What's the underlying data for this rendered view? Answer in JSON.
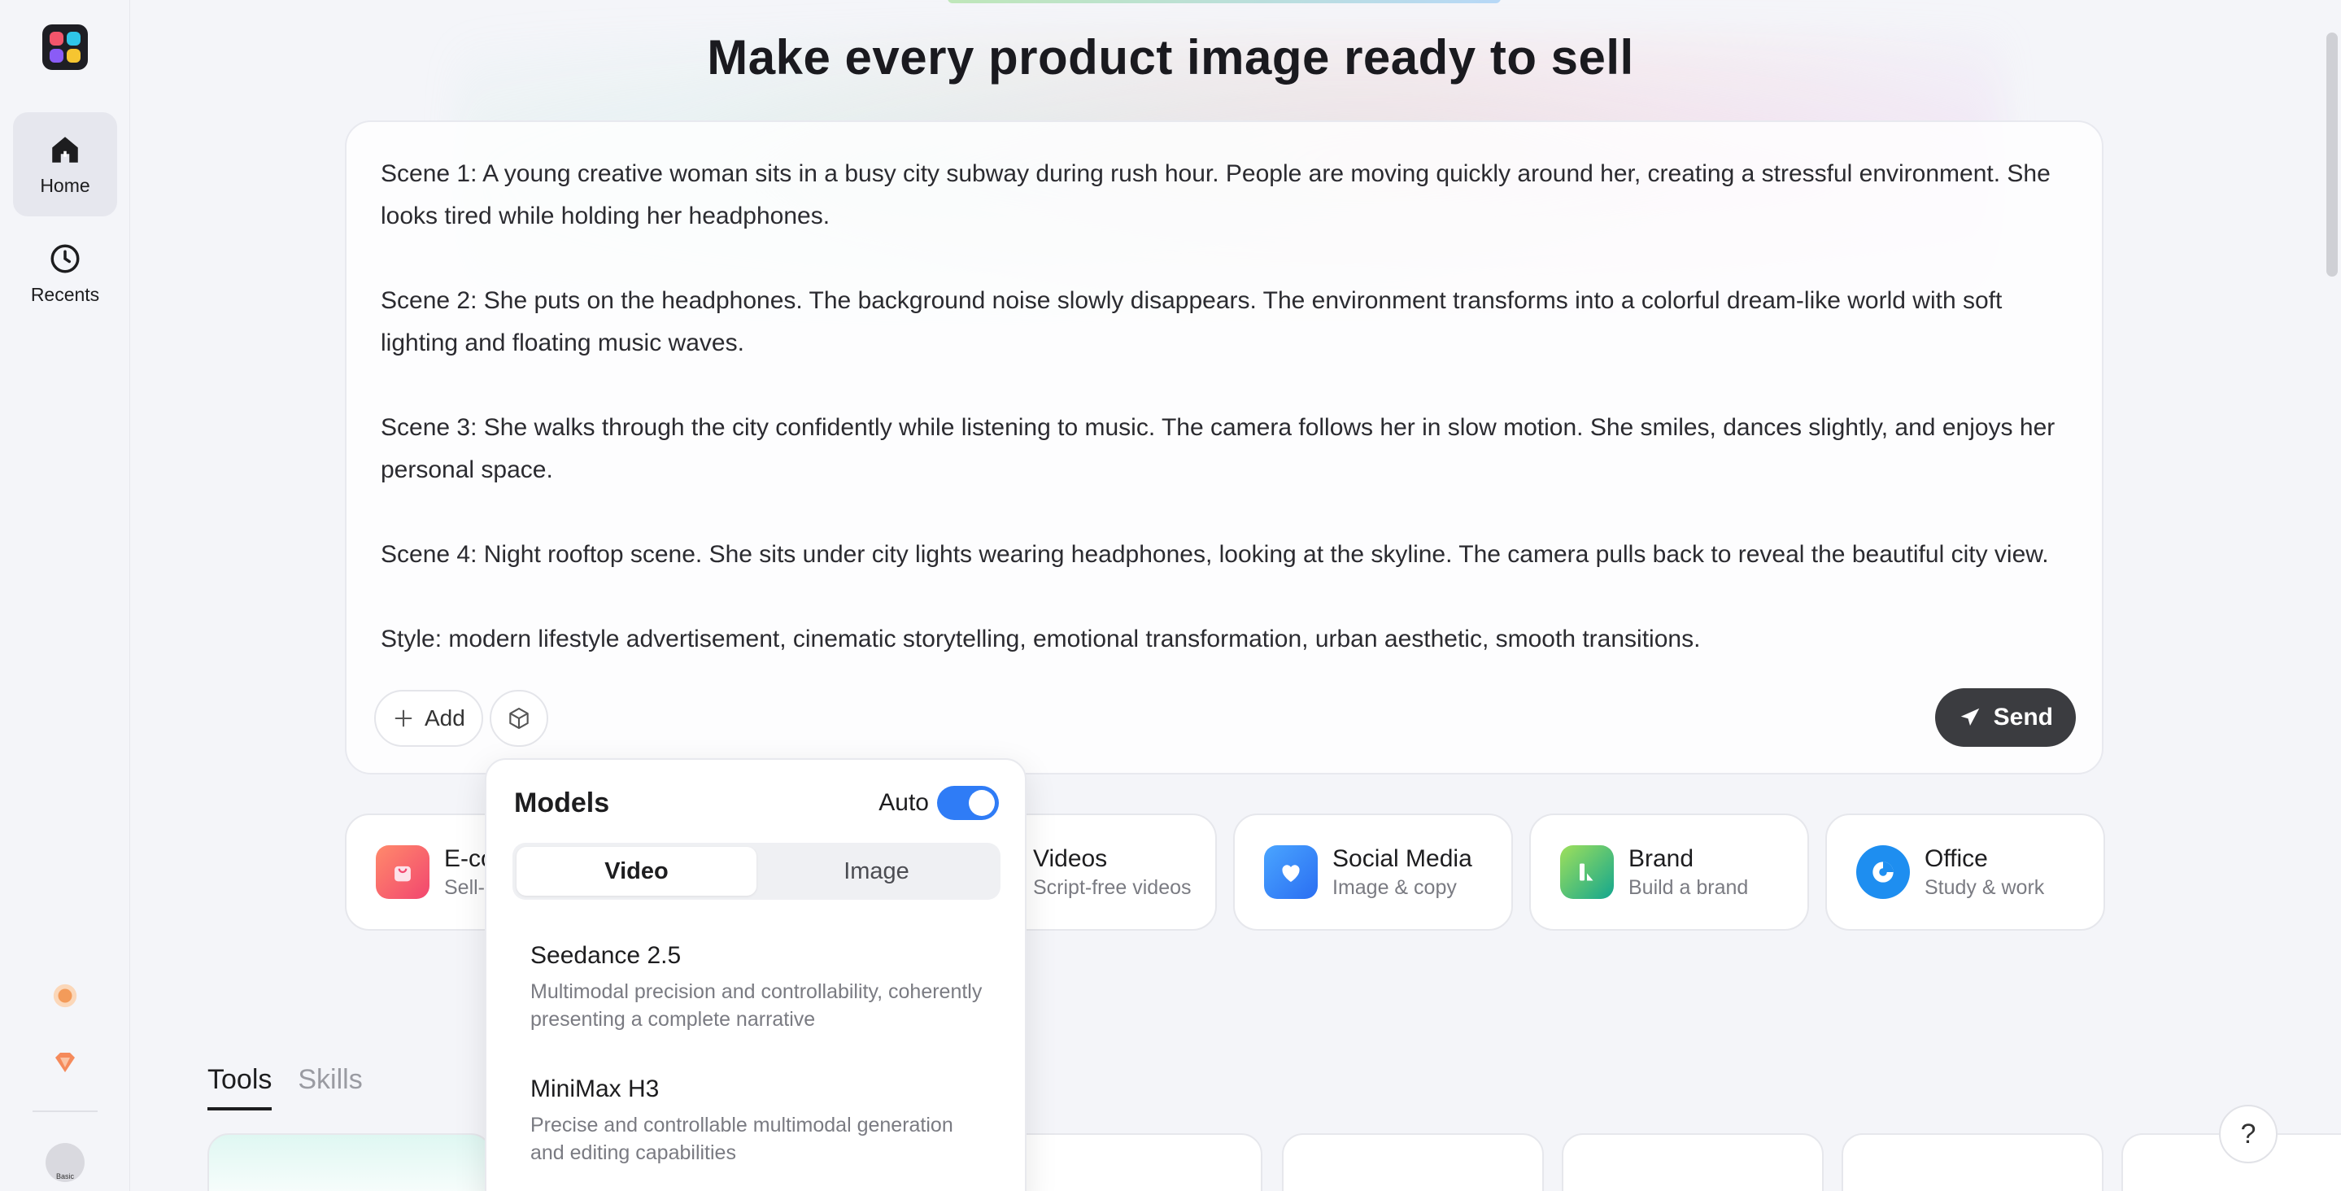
{
  "sidebar": {
    "items": [
      {
        "label": "Home",
        "icon": "home-icon",
        "active": true
      },
      {
        "label": "Recents",
        "icon": "clock-icon",
        "active": false
      }
    ],
    "avatar_badge": "Basic"
  },
  "hero": {
    "title": "Make every product image ready to sell"
  },
  "prompt": {
    "text": "Scene 1: A young creative woman sits in a busy city subway during rush hour. People are moving quickly around her, creating a stressful environment. She looks tired while holding her headphones.\n\nScene 2: She puts on the headphones. The background noise slowly disappears. The environment transforms into a colorful dream-like world with soft lighting and floating music waves.\n\nScene 3: She walks through the city confidently while listening to music. The camera follows her in slow motion. She smiles, dances slightly, and enjoys her personal space.\n\nScene 4: Night rooftop scene. She sits under city lights wearing headphones, looking at the skyline. The camera pulls back to reveal the beautiful city view.\n\nStyle: modern lifestyle advertisement, cinematic storytelling, emotional transformation, urban aesthetic, smooth transitions.",
    "add_label": "Add",
    "send_label": "Send"
  },
  "categories": [
    {
      "title": "E-co",
      "subtitle": "Sell-r",
      "icon": "shopping-bag-icon",
      "color": "#f2686a"
    },
    {
      "title": "Videos",
      "subtitle": "Script-free videos",
      "icon": "video-icon",
      "color": "#7c5cf6"
    },
    {
      "title": "Social Media",
      "subtitle": "Image & copy",
      "icon": "heart-chat-icon",
      "color": "#2f8af5"
    },
    {
      "title": "Brand",
      "subtitle": "Build a brand",
      "icon": "brand-icon",
      "color": "#23b07d"
    },
    {
      "title": "Office",
      "subtitle": "Study & work",
      "icon": "pie-chart-icon",
      "color": "#1e8ef0"
    }
  ],
  "tabs": [
    {
      "label": "Tools",
      "active": true
    },
    {
      "label": "Skills",
      "active": false
    }
  ],
  "models_popup": {
    "title": "Models",
    "auto_label": "Auto",
    "auto_enabled": true,
    "segments": [
      {
        "label": "Video",
        "active": true
      },
      {
        "label": "Image",
        "active": false
      }
    ],
    "models": [
      {
        "name": "Seedance 2.5",
        "description": "Multimodal precision and controllability, coherently presenting a complete narrative"
      },
      {
        "name": "MiniMax H3",
        "description": "Precise and controllable multimodal generation and editing capabilities"
      }
    ]
  },
  "help_label": "?"
}
